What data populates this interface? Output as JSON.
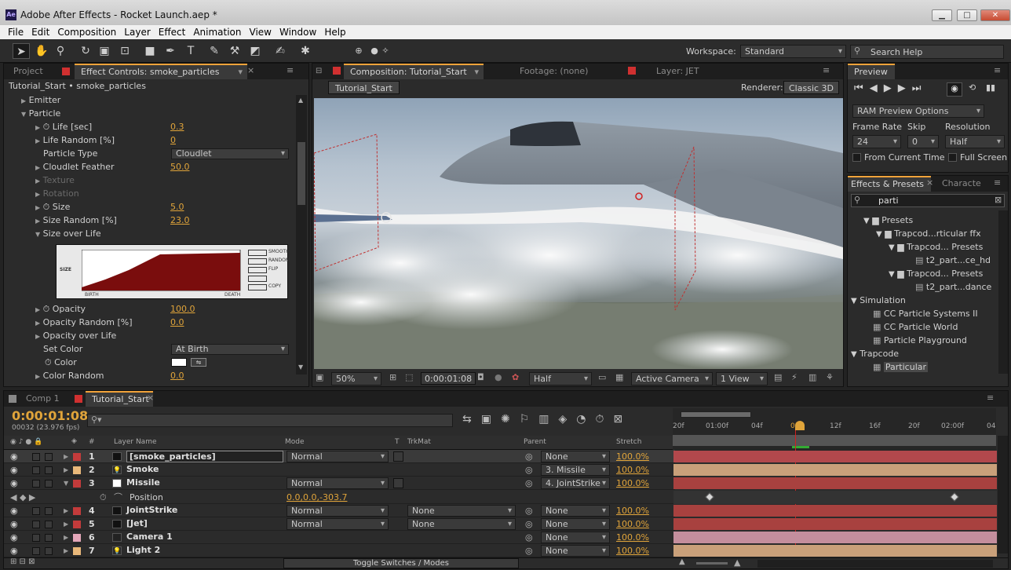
{
  "window": {
    "app_badge": "Ae",
    "title": "Adobe After Effects - Rocket Launch.aep *",
    "min": "▁",
    "max": "□",
    "close": "✕"
  },
  "menu": [
    "File",
    "Edit",
    "Composition",
    "Layer",
    "Effect",
    "Animation",
    "View",
    "Window",
    "Help"
  ],
  "toolbar": {
    "workspace_label": "Workspace:",
    "workspace_value": "Standard",
    "search_placeholder": "Search Help"
  },
  "left_panel": {
    "tabs": {
      "project": "Project",
      "effect_controls": "Effect Controls: smoke_particles"
    },
    "header": "Tutorial_Start • smoke_particles",
    "rows": {
      "emitter": "Emitter",
      "particle": "Particle",
      "life": "Life [sec]",
      "life_val": "0.3",
      "life_random": "Life Random [%]",
      "life_random_val": "0",
      "particle_type": "Particle Type",
      "particle_type_val": "Cloudlet",
      "cloudlet_feather": "Cloudlet Feather",
      "cloudlet_feather_val": "50.0",
      "texture": "Texture",
      "rotation": "Rotation",
      "size": "Size",
      "size_val": "5.0",
      "size_random": "Size Random [%]",
      "size_random_val": "23.0",
      "size_over_life": "Size over Life",
      "opacity": "Opacity",
      "opacity_val": "100.0",
      "opacity_random": "Opacity Random [%]",
      "opacity_random_val": "0.0",
      "opacity_over_life": "Opacity over Life",
      "set_color": "Set Color",
      "set_color_val": "At Birth",
      "color": "Color",
      "color_random": "Color Random",
      "color_random_val": "0.0"
    },
    "graph": {
      "size_label": "SIZE",
      "birth": "BIRTH",
      "death": "DEATH",
      "buttons": [
        "SMOOTH",
        "RANDOM",
        "FLIP",
        "",
        "",
        "COPY"
      ]
    }
  },
  "comp_panel": {
    "tabs": {
      "composition": "Composition: Tutorial_Start",
      "footage": "Footage: (none)",
      "layer": "Layer: JET"
    },
    "comp_name": "Tutorial_Start",
    "renderer_label": "Renderer:",
    "renderer_value": "Classic 3D",
    "footer": {
      "zoom": "50%",
      "timecode": "0:00:01:08",
      "resolution": "Half",
      "camera": "Active Camera",
      "view": "1 View"
    }
  },
  "preview_panel": {
    "tab": "Preview",
    "ram_options": "RAM Preview Options",
    "frame_rate_label": "Frame Rate",
    "skip_label": "Skip",
    "resolution_label": "Resolution",
    "frame_rate": "24",
    "skip": "0",
    "resolution": "Half",
    "from_current": "From Current Time",
    "full_screen": "Full Screen"
  },
  "effects_panel": {
    "tabs": {
      "effects": "Effects & Presets",
      "character": "Characte"
    },
    "search": "parti",
    "tree": [
      "Presets",
      "Trapcod...rticular ffx",
      "Trapcod... Presets",
      "t2_part...ce_hd",
      "Trapcod... Presets",
      "t2_part...dance",
      "Simulation",
      "CC Particle Systems II",
      "CC Particle World",
      "Particle Playground",
      "Trapcode",
      "Particular"
    ]
  },
  "timeline": {
    "tabs": {
      "comp1": "Comp 1",
      "tutorial": "Tutorial_Start"
    },
    "timecode": "0:00:01:08",
    "frame_info": "00032 (23.976 fps)",
    "columns": {
      "num": "#",
      "layer_name": "Layer Name",
      "mode": "Mode",
      "t": "T",
      "trkmat": "TrkMat",
      "parent": "Parent",
      "stretch": "Stretch"
    },
    "ruler": [
      "20f",
      "01:00f",
      "04f",
      "08f",
      "12f",
      "16f",
      "20f",
      "02:00f",
      "04"
    ],
    "layers": [
      {
        "num": "1",
        "name": "[smoke_particles]",
        "mode": "Normal",
        "trkmat": "",
        "parent": "None",
        "stretch": "100.0%",
        "color": "#c33b3b",
        "bar": "#b2484c"
      },
      {
        "num": "2",
        "name": "Smoke",
        "mode": "",
        "trkmat": "",
        "parent": "3. Missile",
        "stretch": "100.0%",
        "color": "#e9b87a",
        "bar": "#c9a07a"
      },
      {
        "num": "3",
        "name": "Missile",
        "mode": "Normal",
        "trkmat": "",
        "parent": "4. JointStrike",
        "stretch": "100.0%",
        "color": "#c33b3b",
        "bar": "#a8413f"
      },
      {
        "num": "4",
        "name": "JointStrike",
        "mode": "Normal",
        "trkmat": "None",
        "parent": "None",
        "stretch": "100.0%",
        "color": "#c33b3b",
        "bar": "#a8413f"
      },
      {
        "num": "5",
        "name": "[Jet]",
        "mode": "Normal",
        "trkmat": "None",
        "parent": "None",
        "stretch": "100.0%",
        "color": "#c33b3b",
        "bar": "#a8413f"
      },
      {
        "num": "6",
        "name": "Camera 1",
        "mode": "",
        "trkmat": "",
        "parent": "None",
        "stretch": "100.0%",
        "color": "#e4a7b9",
        "bar": "#c48e9d"
      },
      {
        "num": "7",
        "name": "Light 2",
        "mode": "",
        "trkmat": "",
        "parent": "None",
        "stretch": "100.0%",
        "color": "#e9b87a",
        "bar": "#c9a07a"
      }
    ],
    "position_label": "Position",
    "position_value": "0.0,0.0,-303.7",
    "toggle_label": "Toggle Switches / Modes"
  }
}
